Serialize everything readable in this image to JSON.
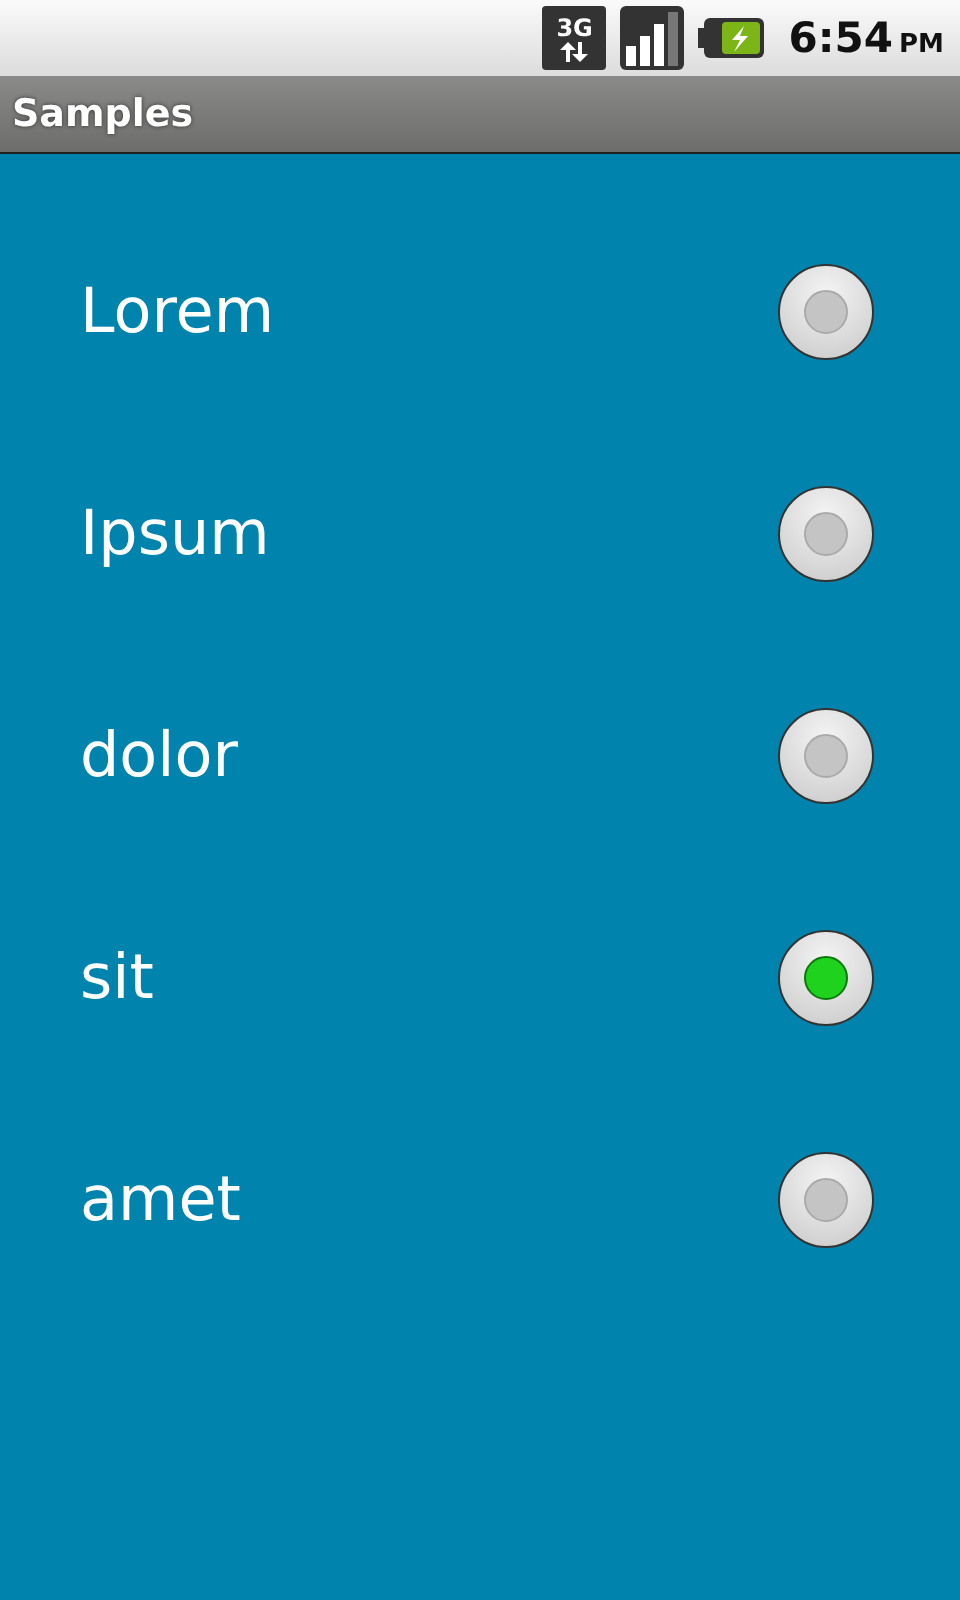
{
  "status_bar": {
    "network": "3G",
    "time": "6:54",
    "meridiem": "PM"
  },
  "title_bar": {
    "title": "Samples"
  },
  "options": [
    {
      "label": "Lorem",
      "selected": false
    },
    {
      "label": "Ipsum",
      "selected": false
    },
    {
      "label": "dolor",
      "selected": false
    },
    {
      "label": "sit",
      "selected": true
    },
    {
      "label": "amet",
      "selected": false
    }
  ]
}
